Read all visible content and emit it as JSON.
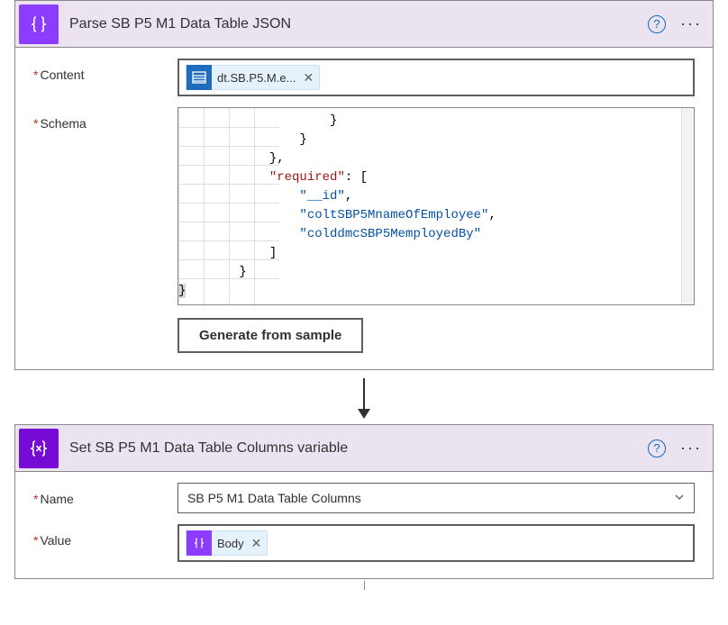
{
  "card1": {
    "title": "Parse SB P5 M1 Data Table JSON",
    "fields": {
      "content_label": "Content",
      "schema_label": "Schema"
    },
    "content_token": "dt.SB.P5.M.e...",
    "schema_code": {
      "line1_brace": "}",
      "line2_brace": "}",
      "line3_brace": "},",
      "line4_key": "\"required\"",
      "line4_punc": ": [",
      "line5_str": "\"__id\"",
      "line5_punc": ",",
      "line6_str": "\"coltSBP5MnameOfEmployee\"",
      "line6_punc": ",",
      "line7_str": "\"colddmcSBP5MemployedBy\"",
      "line8_punc": "]",
      "line9_brace": "}",
      "line10_brace": "}"
    },
    "generate_btn": "Generate from sample"
  },
  "card2": {
    "title": "Set SB P5 M1 Data Table Columns variable",
    "fields": {
      "name_label": "Name",
      "value_label": "Value"
    },
    "name_value": "SB P5 M1 Data Table Columns",
    "value_token": "Body"
  },
  "chart_data": null
}
